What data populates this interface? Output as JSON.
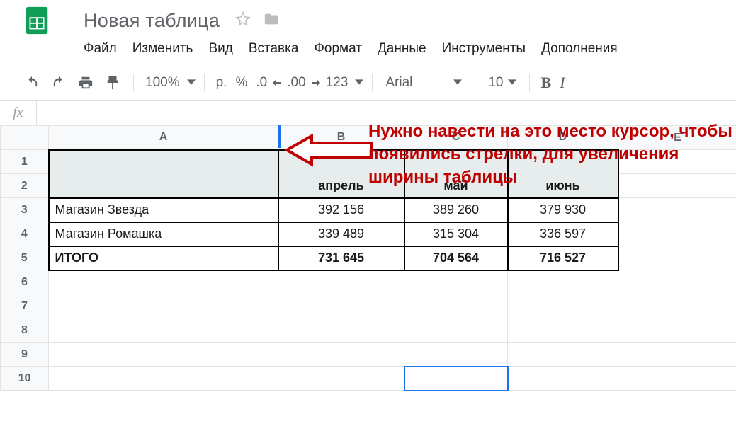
{
  "title": "Новая таблица",
  "menu": [
    "Файл",
    "Изменить",
    "Вид",
    "Вставка",
    "Формат",
    "Данные",
    "Инструменты",
    "Дополнения"
  ],
  "toolbar": {
    "zoom": "100%",
    "currency": "р.",
    "percent": "%",
    "dec_less": ".0",
    "dec_more": ".00",
    "num_format": "123",
    "font": "Arial",
    "font_size": "10",
    "bold": "B",
    "italic": "I"
  },
  "fx_label": "fx",
  "columns": [
    "A",
    "B",
    "C",
    "D",
    "E"
  ],
  "rows": [
    "1",
    "2",
    "3",
    "4",
    "5",
    "6",
    "7",
    "8",
    "9",
    "10"
  ],
  "data": {
    "header": {
      "A": "",
      "B": "апрель",
      "C": "май",
      "D": "июнь"
    },
    "r3": {
      "A": "Магазин Звезда",
      "B": "392 156",
      "C": "389 260",
      "D": "379 930"
    },
    "r4": {
      "A": "Магазин Ромашка",
      "B": "339 489",
      "C": "315 304",
      "D": "336 597"
    },
    "r5": {
      "A": "ИТОГО",
      "B": "731 645",
      "C": "704 564",
      "D": "716 527"
    }
  },
  "annotation_text": "Нужно навести на это место курсор, чтобы появились стрелки, для увеличения ширины таблицы",
  "chart_data": {
    "type": "table",
    "title": "",
    "columns": [
      "",
      "апрель",
      "май",
      "июнь"
    ],
    "rows": [
      [
        "Магазин Звезда",
        392156,
        389260,
        379930
      ],
      [
        "Магазин Ромашка",
        339489,
        315304,
        336597
      ],
      [
        "ИТОГО",
        731645,
        704564,
        716527
      ]
    ]
  }
}
